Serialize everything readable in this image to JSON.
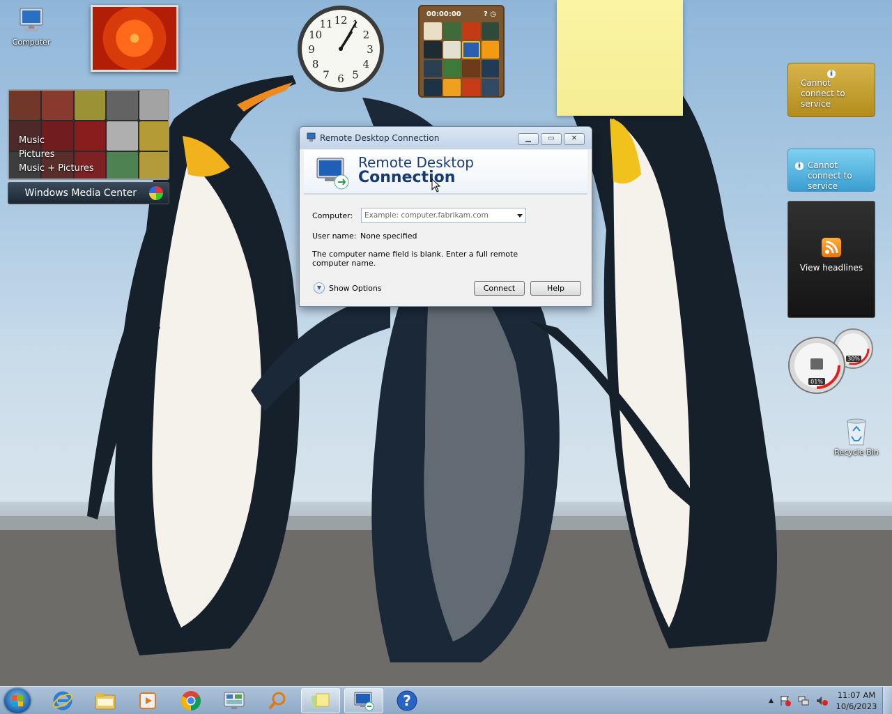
{
  "desktop": {
    "icons": [
      {
        "label": "Computer",
        "icon": "computer-icon"
      },
      {
        "label": "Recycle Bin",
        "icon": "recycle-bin-icon"
      }
    ]
  },
  "gadgets": {
    "clock": {
      "hour": 1,
      "minute": 5,
      "numbers": [
        "12",
        "1",
        "2",
        "3",
        "4",
        "5",
        "6",
        "7",
        "8",
        "9",
        "10",
        "11"
      ]
    },
    "puzzle": {
      "timer": "00:00:00"
    },
    "media_center": {
      "menu": [
        "Music",
        "Pictures",
        "Music + Pictures"
      ],
      "title": "Windows Media Center"
    },
    "weather": {
      "message": "Cannot connect to service"
    },
    "currency": {
      "message": "Cannot connect to service"
    },
    "feeds": {
      "label": "View headlines"
    },
    "cpu_meter": {
      "cpu": "01%",
      "memory": "30%"
    }
  },
  "dialog": {
    "window_title": "Remote Desktop Connection",
    "banner_line1": "Remote Desktop",
    "banner_line2": "Connection",
    "computer_label": "Computer:",
    "computer_placeholder": "Example: computer.fabrikam.com",
    "username_label": "User name:",
    "username_value": "None specified",
    "message": "The computer name field is blank. Enter a full remote computer name.",
    "show_options": "Show Options",
    "connect": "Connect",
    "help": "Help"
  },
  "taskbar": {
    "items": [
      "start",
      "internet-explorer",
      "windows-explorer",
      "media-player",
      "chrome",
      "control-panel",
      "search",
      "sticky-notes",
      "remote-desktop",
      "help"
    ],
    "time": "11:07 AM",
    "date": "10/6/2023"
  },
  "colors": {
    "accent": "#163a74",
    "taskbar": "#9fb6d0"
  }
}
